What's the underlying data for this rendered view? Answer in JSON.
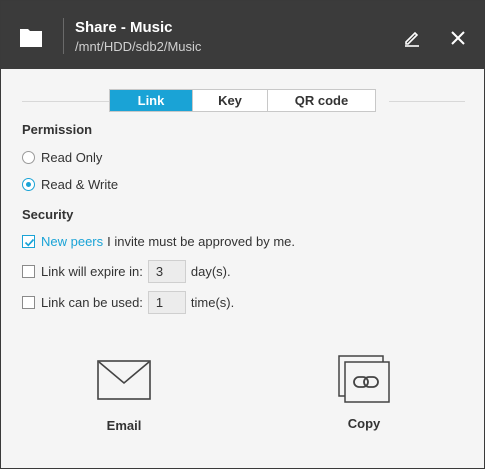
{
  "header": {
    "title": "Share - Music",
    "path": "/mnt/HDD/sdb2/Music",
    "icons": [
      "folder-icon",
      "edit-icon",
      "close-icon"
    ]
  },
  "tabs": [
    {
      "label": "Link",
      "active": true
    },
    {
      "label": "Key",
      "active": false
    },
    {
      "label": "QR code",
      "active": false
    }
  ],
  "permission": {
    "title": "Permission",
    "options": [
      {
        "label": "Read Only",
        "selected": false
      },
      {
        "label": "Read & Write",
        "selected": true
      }
    ]
  },
  "security": {
    "title": "Security",
    "new_peers": {
      "link_text": "New peers",
      "rest_text": "I invite must be approved by me.",
      "checked": true
    },
    "expire": {
      "label": "Link will expire in:",
      "value": "3",
      "unit": "day(s).",
      "checked": false
    },
    "uses": {
      "label": "Link can be used:",
      "value": "1",
      "unit": "time(s).",
      "checked": false
    }
  },
  "actions": {
    "email": {
      "label": "Email",
      "icon": "envelope-icon"
    },
    "copy": {
      "label": "Copy",
      "icon": "copy-link-icon"
    }
  },
  "colors": {
    "accent": "#1aa3d6",
    "header_bg": "#3b3b3b",
    "body_bg": "#f5f5f5"
  }
}
